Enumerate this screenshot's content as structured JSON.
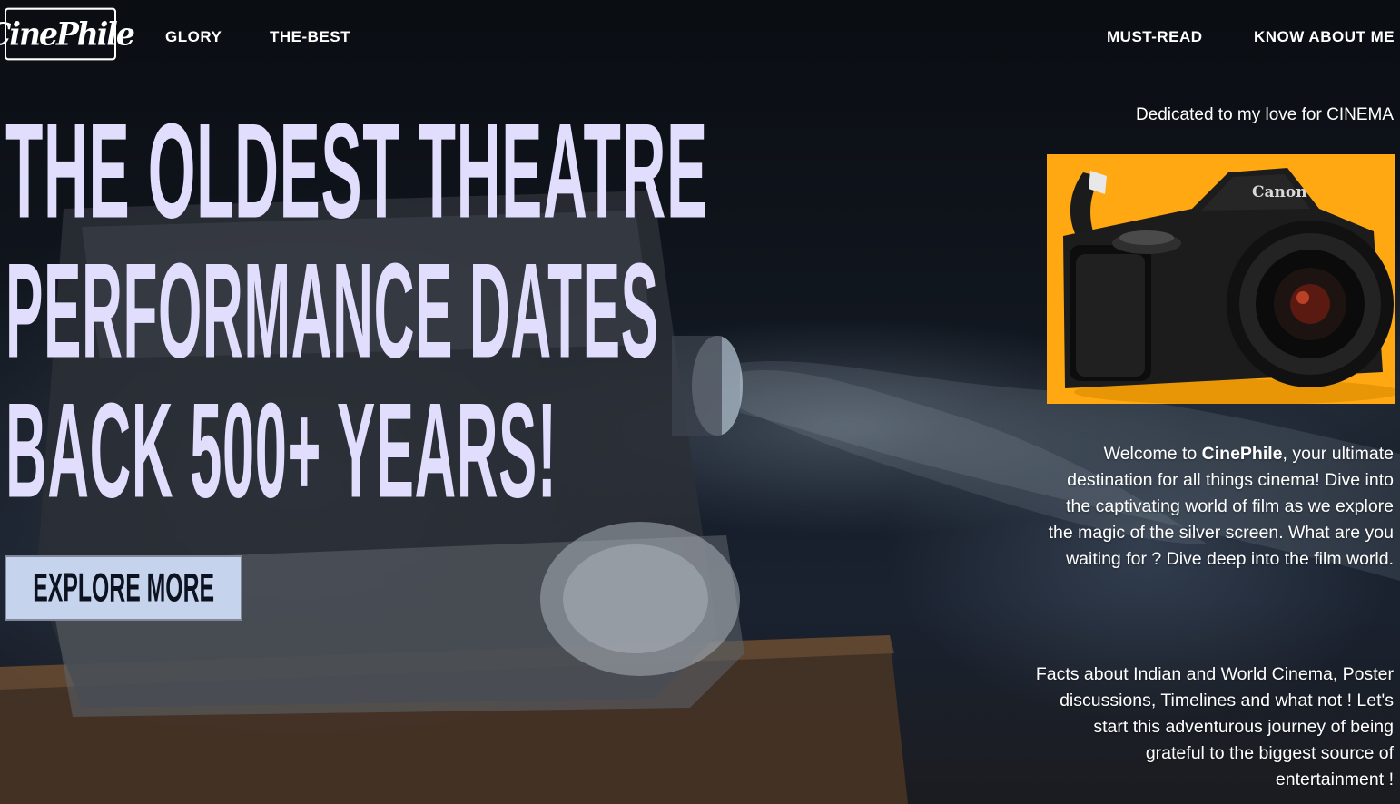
{
  "brand": {
    "logo_text": "CinePhile"
  },
  "nav": {
    "left": [
      "GLORY",
      "THE-BEST"
    ],
    "right": [
      "MUST-READ",
      "KNOW ABOUT ME"
    ]
  },
  "hero": {
    "headline_lines": [
      "THE OLDEST THEATRE",
      "PERFORMANCE DATES",
      "BACK 500+ YEARS!"
    ],
    "cta_label": "EXPLORE MORE",
    "colors": {
      "headline": "#e1ddfc",
      "cta_bg": "#c6d3ec"
    }
  },
  "sidebar": {
    "tagline": "Dedicated to my love for CINEMA",
    "image": {
      "brand_text": "Canon",
      "background_color": "#ffa811"
    },
    "intro": {
      "prefix": "Welcome to ",
      "brand": "CinePhile",
      "suffix": ", your ultimate destination for all things cinema! Dive into the captivating world of film as we explore the magic of the silver screen. What are you waiting for ? Dive deep into the film world."
    },
    "facts": "Facts about Indian and World Cinema, Poster discussions, Timelines and what not ! Let's start this adventurous journey of being grateful to the biggest source of entertainment !"
  }
}
